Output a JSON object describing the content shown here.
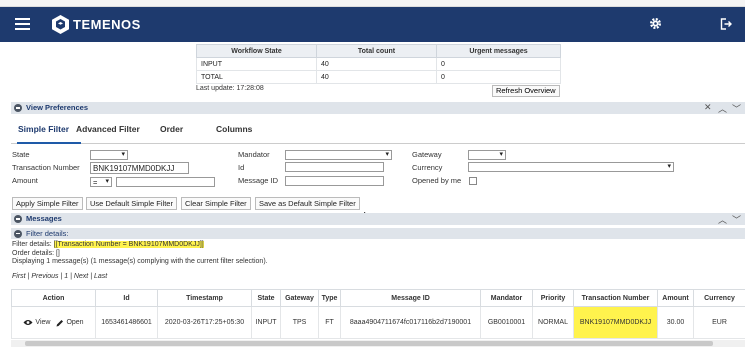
{
  "header": {
    "brand": "TEMENOS"
  },
  "overview": {
    "columns": [
      "Workflow State",
      "Total count",
      "Urgent messages"
    ],
    "rows": [
      [
        "INPUT",
        "40",
        "0"
      ],
      [
        "TOTAL",
        "40",
        "0"
      ]
    ],
    "last_update": "Last update: 17:28:08",
    "refresh_label": "Refresh Overview"
  },
  "view_preferences": {
    "title": "View Preferences",
    "tabs": [
      "Simple Filter",
      "Advanced Filter",
      "Order",
      "Columns"
    ]
  },
  "filter": {
    "state_label": "State",
    "txn_label": "Transaction Number",
    "txn_value": "BNK19107MMD0DKJJ",
    "amount_label": "Amount",
    "amount_op": "=",
    "mandator_label": "Mandator",
    "id_label": "Id",
    "message_id_label": "Message ID",
    "gateway_label": "Gateway",
    "currency_label": "Currency",
    "opened_label": "Opened by me"
  },
  "buttons": {
    "apply": "Apply Simple Filter",
    "use_default": "Use Default Simple Filter",
    "clear": "Clear Simple Filter",
    "save_default": "Save as Default Simple Filter"
  },
  "messages": {
    "title": "Messages",
    "filter_details_title": "Filter details:",
    "filter_details_prefix": "Filter details: ",
    "filter_details_value": "[[Transaction Number = BNK19107MMD0DKJJ]]",
    "order_details": "Order details: []",
    "displaying": "Displaying 1 message(s) (1 message(s) complying with the current filter selection).",
    "pager": "First | Previous | 1 | Next | Last",
    "columns": [
      "Action",
      "Id",
      "Timestamp",
      "State",
      "Gateway",
      "Type",
      "Message ID",
      "Mandator",
      "Priority",
      "Transaction Number",
      "Amount",
      "Currency"
    ],
    "row": {
      "view": "View",
      "open": "Open",
      "id": "1653461486601",
      "timestamp": "2020-03-26T17:25+05:30",
      "state": "INPUT",
      "gateway": "TPS",
      "type": "FT",
      "message_id": "8aaa4904711674fc017116b2d7190001",
      "mandator": "GB0010001",
      "priority": "NORMAL",
      "txn": "BNK19107MMD0DKJJ",
      "amount": "30.00",
      "currency": "EUR"
    }
  },
  "colors": {
    "header_bg": "#1e3a6e",
    "highlight": "#fff34d",
    "section_bg": "#dfe4ea"
  },
  "icons": [
    "hamburger-icon",
    "temenos-logo-icon",
    "gear-icon",
    "logout-icon",
    "collapse-icon",
    "close-icon",
    "chevron-up-icon",
    "chevron-down-icon",
    "eye-icon",
    "pencil-icon",
    "cursor-icon"
  ]
}
